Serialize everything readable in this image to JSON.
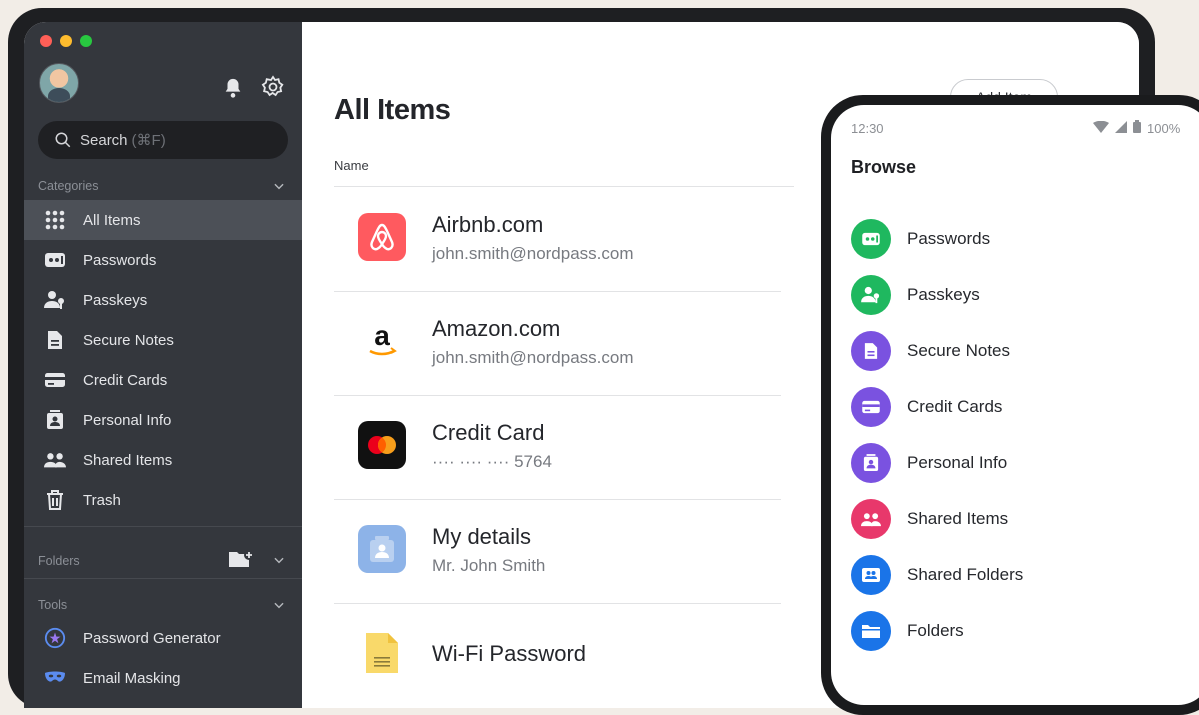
{
  "desktop": {
    "search": {
      "label": "Search",
      "shortcut": "(⌘F)"
    },
    "categories_label": "Categories",
    "categories": [
      {
        "label": "All Items",
        "icon": "grid-icon"
      },
      {
        "label": "Passwords",
        "icon": "password-icon"
      },
      {
        "label": "Passkeys",
        "icon": "passkey-icon"
      },
      {
        "label": "Secure Notes",
        "icon": "note-icon"
      },
      {
        "label": "Credit Cards",
        "icon": "credit-card-icon"
      },
      {
        "label": "Personal Info",
        "icon": "id-badge-icon"
      },
      {
        "label": "Shared Items",
        "icon": "shared-users-icon"
      },
      {
        "label": "Trash",
        "icon": "trash-icon"
      }
    ],
    "folders_label": "Folders",
    "tools_label": "Tools",
    "tools": [
      {
        "label": "Password Generator",
        "icon": "generator-icon"
      },
      {
        "label": "Email Masking",
        "icon": "mask-icon"
      }
    ],
    "page_title": "All Items",
    "add_button": "Add Item",
    "column_name": "Name",
    "items": [
      {
        "title": "Airbnb.com",
        "subtitle": "john.smith@nordpass.com",
        "icon": "airbnb-logo",
        "color": "#ff5a5f"
      },
      {
        "title": "Amazon.com",
        "subtitle": "john.smith@nordpass.com",
        "icon": "amazon-logo",
        "color": "#ffffff"
      },
      {
        "title": "Credit Card",
        "subtitle": "···· ···· ···· 5764",
        "icon": "mastercard-logo",
        "color": "#111111"
      },
      {
        "title": "My details",
        "subtitle": "Mr. John Smith",
        "icon": "personal-info-icon",
        "color": "#8db3e8"
      },
      {
        "title": "Wi-Fi Password",
        "subtitle": "",
        "icon": "note-icon",
        "color": "#f9d96a"
      }
    ]
  },
  "phone": {
    "time": "12:30",
    "battery": "100%",
    "title": "Browse",
    "items": [
      {
        "label": "Passwords",
        "icon": "password-icon",
        "color": "#1fb85f"
      },
      {
        "label": "Passkeys",
        "icon": "passkey-icon",
        "color": "#1fb85f"
      },
      {
        "label": "Secure Notes",
        "icon": "note-icon",
        "color": "#7a52e0"
      },
      {
        "label": "Credit Cards",
        "icon": "credit-card-icon",
        "color": "#7a52e0"
      },
      {
        "label": "Personal Info",
        "icon": "id-badge-icon",
        "color": "#7a52e0"
      },
      {
        "label": "Shared Items",
        "icon": "shared-users-icon",
        "color": "#e8386b"
      },
      {
        "label": "Shared Folders",
        "icon": "shared-folder-icon",
        "color": "#1a74e8"
      },
      {
        "label": "Folders",
        "icon": "folder-icon",
        "color": "#1a74e8"
      }
    ]
  }
}
